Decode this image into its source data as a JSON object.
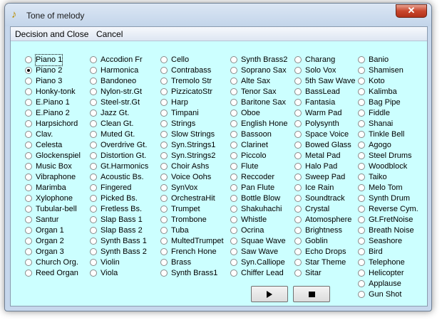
{
  "window": {
    "title": "Tone of melody",
    "close_glyph": "✕",
    "app_icon": "music-note-icon"
  },
  "menu": {
    "decision": "Decision and Close",
    "cancel": "Cancel"
  },
  "selected": "Piano 2",
  "instruments": [
    [
      "Piano 1",
      "Piano 2",
      "Piano 3",
      "Honky-tonk",
      "E.Piano 1",
      "E.Piano 2",
      "Harpsichord",
      "Clav.",
      "Celesta",
      "Glockenspiel",
      "Music Box",
      "Vibraphone",
      "Marimba",
      "Xylophone",
      "Tubular-bell",
      "Santur",
      "Organ 1",
      "Organ 2",
      "Organ 3",
      "Church Org.",
      "Reed Organ"
    ],
    [
      "Accodion Fr",
      "Harmonica",
      "Bandoneo",
      "Nylon-str.Gt",
      "Steel-str.Gt",
      "Jazz Gt.",
      "Clean Gt.",
      "Muted Gt.",
      "Overdrive Gt.",
      "Distortion Gt.",
      "Gt.Harmonics",
      "Acoustic Bs.",
      "Fingered",
      "Picked Bs.",
      "Fretless Bs.",
      "Slap Bass 1",
      "Slap Bass 2",
      "Synth Bass 1",
      "Synth Bass 2",
      "Violin",
      "Viola"
    ],
    [
      "Cello",
      "Contrabass",
      "Tremolo Str",
      "PizzicatoStr",
      "Harp",
      "Timpani",
      "Strings",
      "Slow Strings",
      "Syn.Strings1",
      "Syn.Strings2",
      "Choir Ashs",
      "Voice Oohs",
      "SynVox",
      "OrchestraHit",
      "Trumpet",
      "Trombone",
      "Tuba",
      "MultedTrumpet",
      "French Hone",
      "Brass",
      "Synth Brass1"
    ],
    [
      "Synth Brass2",
      "Soprano Sax",
      "Alte Sax",
      "Tenor Sax",
      "Baritone Sax",
      "Oboe",
      "English Hone",
      "Bassoon",
      "Clarinet",
      "Piccolo",
      "Flute",
      "Reccoder",
      "Pan Flute",
      "Bottle Blow",
      "Shakuhachi",
      "Whistle",
      "Ocrina",
      "Squae Wave",
      "Saw Wave",
      "Syn.Calliope",
      "Chiffer Lead"
    ],
    [
      "Charang",
      "Solo Vox",
      "5th Saw Wave",
      "BassLead",
      "Fantasia",
      "Warm Pad",
      "Polysynth",
      "Space Voice",
      "Bowed Glass",
      "Metal Pad",
      "Halo Pad",
      "Sweep Pad",
      "Ice Rain",
      "Soundtrack",
      "Crystal",
      "Atomosphere",
      "Brightness",
      "Goblin",
      "Echo Drops",
      "Star Theme",
      "Sitar"
    ],
    [
      "Banio",
      "Shamisen",
      "Koto",
      "Kalimba",
      "Bag Pipe",
      "Fiddle",
      "Shanai",
      "Tinkle Bell",
      "Agogo",
      "Steel Drums",
      "Woodblock",
      "Taiko",
      "Melo Tom",
      "Synth Drum",
      "Reverse Cym.",
      "Gt.FretNoise",
      "Breath Noise",
      "Seashore",
      "Bird",
      "Telephone",
      "Helicopter",
      "Applause",
      "Gun Shot"
    ]
  ],
  "controls": {
    "play_icon": "play-icon",
    "stop_icon": "stop-icon"
  }
}
